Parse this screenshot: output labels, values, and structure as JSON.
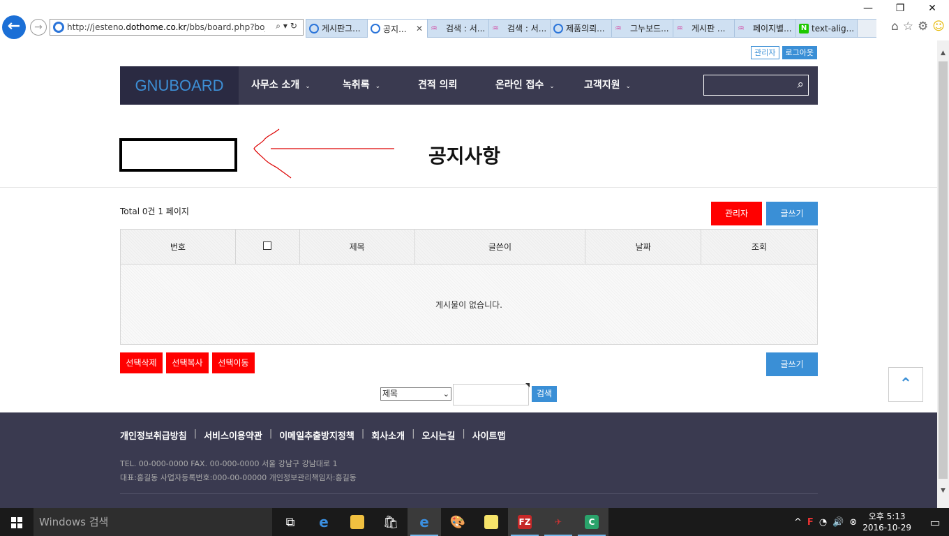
{
  "browser": {
    "url_prefix": "http://jesteno.",
    "url_domain": "dothome.co.kr",
    "url_path": "/bbs/board.php?bo_tabl",
    "tabs": [
      {
        "label": "게시판그...",
        "icon": "ie"
      },
      {
        "label": "공지...",
        "icon": "ie",
        "active": true
      },
      {
        "label": "검색 : 서...",
        "icon": "pink"
      },
      {
        "label": "검색 : 서...",
        "icon": "pink"
      },
      {
        "label": "제품의뢰...",
        "icon": "ie"
      },
      {
        "label": "그누보드...",
        "icon": "pink"
      },
      {
        "label": "게시판 ...",
        "icon": "pink"
      },
      {
        "label": "페이지별...",
        "icon": "pink"
      },
      {
        "label": "text-alig...",
        "icon": "naver"
      }
    ]
  },
  "top_links": {
    "admin": "관리자",
    "logout": "로그아웃"
  },
  "nav": {
    "logo": "GNUBOARD",
    "items": [
      {
        "label": "사무소 소개",
        "has_dropdown": true
      },
      {
        "label": "녹취록",
        "has_dropdown": true
      },
      {
        "label": "견적 의뢰",
        "has_dropdown": false
      },
      {
        "label": "온라인 접수",
        "has_dropdown": true
      },
      {
        "label": "고객지원",
        "has_dropdown": true
      }
    ]
  },
  "board": {
    "title": "공지사항",
    "total": "Total 0건 1 페이지",
    "admin_button": "관리자",
    "write_button": "글쓰기",
    "columns": [
      "번호",
      "",
      "제목",
      "글쓴이",
      "날짜",
      "조회"
    ],
    "empty_message": "게시물이 없습니다.",
    "bulk_actions": [
      "선택삭제",
      "선택복사",
      "선택이동"
    ],
    "search": {
      "field_selected": "제목",
      "query": "",
      "button": "검색"
    }
  },
  "footer": {
    "links": [
      "개인정보취급방침",
      "서비스이용약관",
      "이메일추출방지정책",
      "회사소개",
      "오시는길",
      "사이트맵"
    ],
    "info_line1": "TEL. 00-000-0000 FAX. 00-000-0000 서울 강남구 강남대로 1",
    "info_line2": "대표:홍길동 사업자등록번호:000-00-00000 개인정보관리책임자:홍길동"
  },
  "taskbar": {
    "search_placeholder": "Windows 검색",
    "clock_period": "오후 5:13",
    "clock_date": "2016-10-29"
  },
  "colors": {
    "nav_bg": "#3a3a50",
    "accent_blue": "#3a8fd6",
    "danger_red": "#ff0000"
  }
}
